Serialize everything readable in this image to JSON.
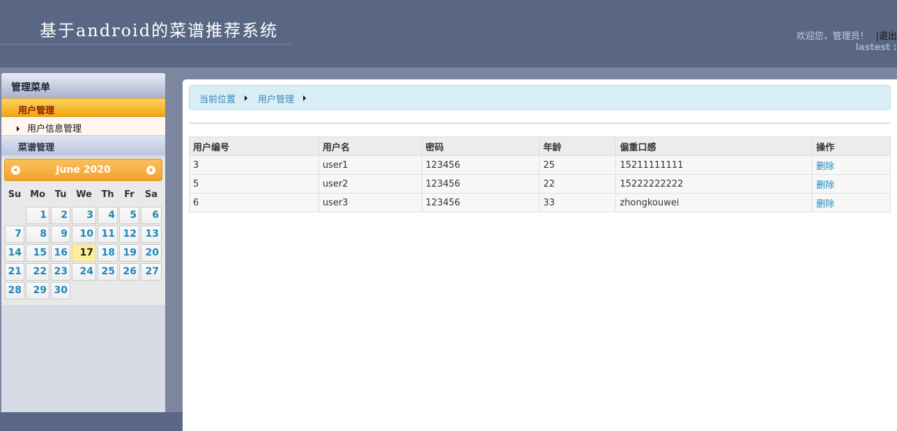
{
  "header": {
    "title": "基于android的菜谱推荐系统",
    "welcome": "欢迎您，管理员！",
    "separator": "|",
    "logout": "退出",
    "lastest": "lastest :"
  },
  "sidebar": {
    "heading": "管理菜单",
    "groups": [
      {
        "label": "用户管理",
        "items": [
          {
            "label": "用户信息管理"
          }
        ]
      },
      {
        "label": "菜谱管理"
      }
    ]
  },
  "calendar": {
    "title": "June 2020",
    "weekdays": [
      "Su",
      "Mo",
      "Tu",
      "We",
      "Th",
      "Fr",
      "Sa"
    ],
    "first_weekday_index": 1,
    "days_in_month": 30,
    "today": 17
  },
  "breadcrumb": {
    "items": [
      "当前位置",
      "用户管理"
    ]
  },
  "table": {
    "headers": [
      "用户编号",
      "用户名",
      "密码",
      "年龄",
      "偏重口感",
      "操作"
    ],
    "rows": [
      [
        "3",
        "user1",
        "123456",
        "25",
        "15211111111",
        "删除"
      ],
      [
        "5",
        "user2",
        "123456",
        "22",
        "15222222222",
        "删除"
      ],
      [
        "6",
        "user3",
        "123456",
        "33",
        "zhongkouwei",
        "删除"
      ]
    ]
  },
  "colors": {
    "header_bg": "#5a6784",
    "accent_orange": "#f3a22a",
    "link_blue": "#1d8ac0"
  }
}
